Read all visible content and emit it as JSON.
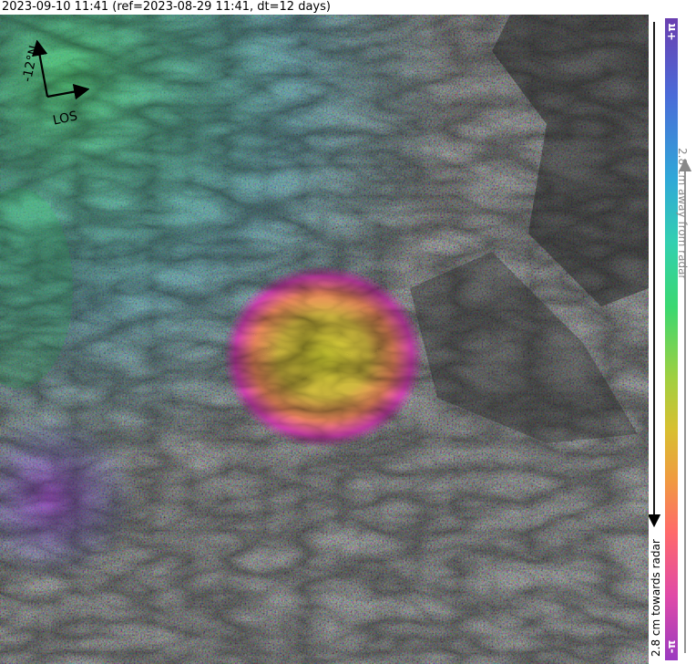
{
  "title": "2023-09-10 11:41 (ref=2023-08-29 11:41, dt=12 days)",
  "compass": {
    "north_label": "-12°N",
    "los_label": "LOS"
  },
  "colorbar": {
    "top_label": "+π",
    "bottom_label": "-π",
    "away_label": "2.8 cm away from radar",
    "toward_label": "2.8 cm towards radar",
    "colors": [
      "#6a3fb0",
      "#4a6ad8",
      "#2fa8d8",
      "#3ad870",
      "#d8c030",
      "#ff6a6a",
      "#9a3ac0"
    ]
  }
}
